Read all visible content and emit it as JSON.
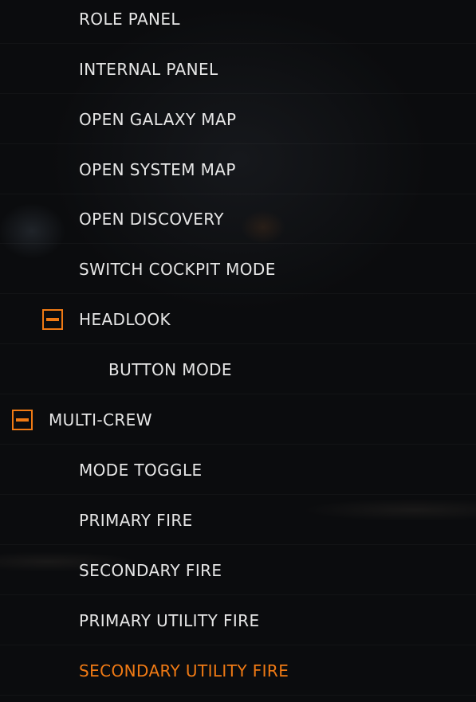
{
  "menu": {
    "items": [
      {
        "label": "ROLE PANEL"
      },
      {
        "label": "INTERNAL PANEL"
      },
      {
        "label": "OPEN GALAXY MAP"
      },
      {
        "label": "OPEN SYSTEM MAP"
      },
      {
        "label": "OPEN DISCOVERY"
      },
      {
        "label": "SWITCH COCKPIT MODE"
      },
      {
        "label": "HEADLOOK",
        "expanded": true
      },
      {
        "label": "BUTTON MODE"
      },
      {
        "label": "MULTI-CREW",
        "expanded": true
      },
      {
        "label": "MODE TOGGLE"
      },
      {
        "label": "PRIMARY FIRE"
      },
      {
        "label": "SECONDARY FIRE"
      },
      {
        "label": "PRIMARY UTILITY FIRE"
      },
      {
        "label": "SECONDARY UTILITY FIRE",
        "active": true
      }
    ]
  },
  "colors": {
    "accent": "#f07a14",
    "text": "#e6e6e6",
    "background": "#0c0d0f"
  },
  "icons": {
    "collapse": "minus-square-icon"
  }
}
